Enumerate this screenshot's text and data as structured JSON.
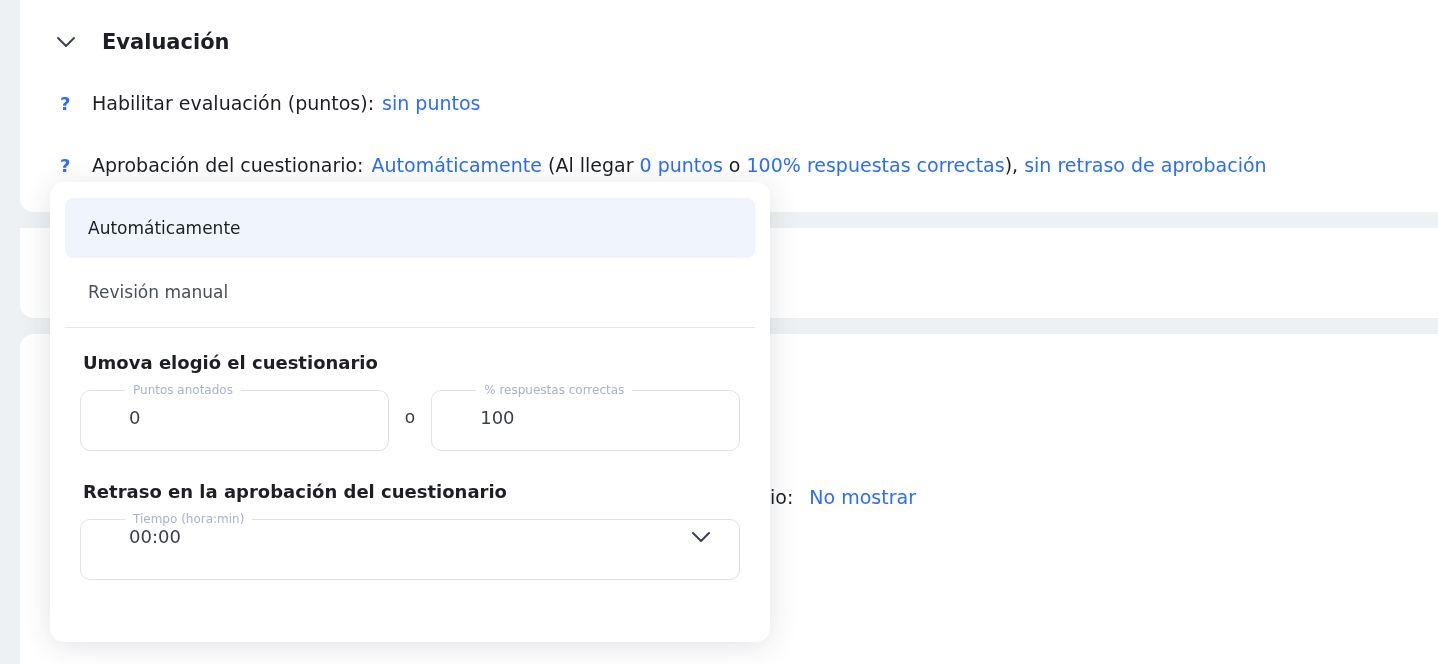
{
  "section": {
    "title": "Evaluación",
    "expanded": true,
    "settings": [
      {
        "help": "?",
        "label": "Habilitar evaluación (puntos):",
        "segments": [
          {
            "kind": "link",
            "text": "sin puntos"
          }
        ]
      },
      {
        "help": "?",
        "label": "Aprobación del cuestionario:",
        "segments": [
          {
            "kind": "link",
            "text": "Automáticamente"
          },
          {
            "kind": "text",
            "text": " (Al llegar "
          },
          {
            "kind": "link",
            "text": "0 puntos"
          },
          {
            "kind": "text",
            "text": " o "
          },
          {
            "kind": "link",
            "text": "100% respuestas correctas"
          },
          {
            "kind": "text",
            "text": "), "
          },
          {
            "kind": "link",
            "text": "sin retraso de aprobación"
          }
        ]
      }
    ]
  },
  "partly_hidden_setting": {
    "label": "io:",
    "value": "No mostrar"
  },
  "popup": {
    "options": [
      {
        "label": "Automáticamente",
        "selected": true
      },
      {
        "label": "Revisión manual",
        "selected": false
      }
    ],
    "approval_heading": "Umova elogió el cuestionario",
    "fields": [
      {
        "label": "Puntos anotados",
        "value": "0"
      },
      {
        "label": "% respuestas correctas",
        "value": "100"
      }
    ],
    "separator": "o",
    "delay_heading": "Retraso en la aprobación del cuestionario",
    "delay_field": {
      "label": "Tiempo (hora:min)",
      "value": "00:00"
    }
  }
}
